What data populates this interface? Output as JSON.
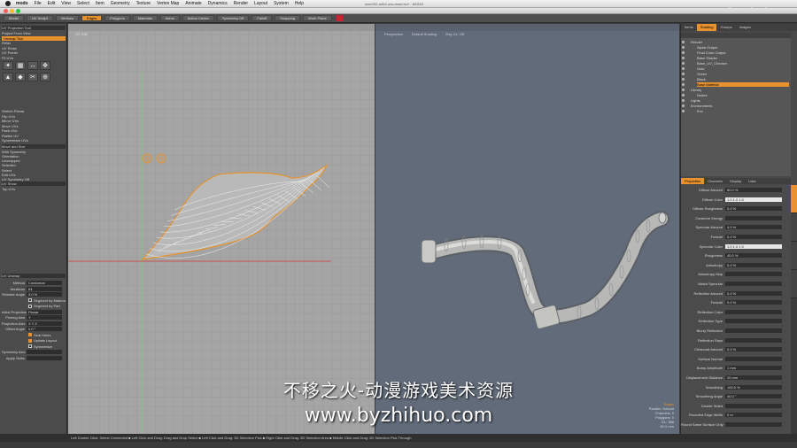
{
  "menubar": {
    "app_name": "modo",
    "items": [
      "File",
      "Edit",
      "View",
      "Select",
      "Item",
      "Geometry",
      "Texture",
      "Vertex Map",
      "Animate",
      "Dynamics",
      "Render",
      "Layout",
      "System",
      "Help"
    ],
    "window_title": "mdo202-a404-uvs-done.lxo* - MODO",
    "clock": "",
    "logo": "fxphd"
  },
  "toolbar": {
    "tabs": [
      "Model",
      "UV Sculpt",
      "Vertices",
      "Edges",
      "Polygons",
      "Materials",
      "Items",
      "Action Center",
      "Symmetry Off",
      "Falloff",
      "Snapping",
      "Work Plane"
    ],
    "active_tab": "Edges"
  },
  "left_panel": {
    "header": "UV Projection Tool",
    "rows": [
      "Project From View",
      "Unwrap Tool",
      "Relax",
      "UV Relax",
      "UV Peeler",
      "Fit UVs"
    ],
    "unwrap_label": "Unwrap Tool",
    "section2": [
      "Stretch Planar",
      "Flip UVs",
      "Mirror UVs",
      "Move UVs",
      "Pack UVs",
      "Flatten UV",
      "Symmetrize UVs"
    ],
    "section3_header": "Move and Size",
    "section3": [
      "With Symmetry",
      "Orientation",
      "Unwrapped",
      "Selected"
    ],
    "section4": [
      "Select",
      "Edit UVs",
      "UV Symmetry Off"
    ],
    "section5_header": "UV Show",
    "section5": [
      "Top UVs"
    ],
    "lower_header": "UV Unwrap",
    "fields": [
      {
        "label": "Method",
        "value": "Conformal"
      },
      {
        "label": "Iterations",
        "value": "64"
      },
      {
        "label": "Relative Angle",
        "value": "3.0 %"
      }
    ],
    "checks1": [
      {
        "label": "Segment by Material",
        "on": false
      },
      {
        "label": "Segment by Part",
        "on": false
      }
    ],
    "fields2": [
      {
        "label": "Initial Projection",
        "value": "Planar"
      },
      {
        "label": "Pinning Axis",
        "value": "Y"
      },
      {
        "label": "Projection Axis",
        "value": "X  Y  Z"
      },
      {
        "label": "Offset Angle",
        "value": "0.0 °"
      }
    ],
    "checks2": [
      {
        "label": "Seal Holes",
        "on": true
      },
      {
        "label": "Update Layout",
        "on": true
      },
      {
        "label": "Symmetrize",
        "on": false
      }
    ],
    "fields3": [
      {
        "label": "Symmetry Axis",
        "value": ""
      },
      {
        "label": "Apply Sides",
        "value": ""
      }
    ]
  },
  "viewport_left": {
    "label": "UV Edit"
  },
  "viewport_right": {
    "labels": [
      "Perspective",
      "Default Shading",
      "Ray GL: Off"
    ],
    "info": [
      "Edges",
      "Parallel: Default",
      "Channels: 0",
      "Polygons: 0",
      "GL: 388",
      "60.0 mm"
    ]
  },
  "right_panel": {
    "top_tabs": [
      "Items",
      "Shading",
      "Groups",
      "Images"
    ],
    "active_top_tab": "Shading",
    "tree_rows": [
      {
        "text": "Render",
        "indent": 1,
        "sel": false
      },
      {
        "text": "Alpha Output",
        "indent": 2,
        "sel": false
      },
      {
        "text": "Final Color Output",
        "indent": 2,
        "sel": false
      },
      {
        "text": "Base Shader",
        "indent": 2,
        "sel": false
      },
      {
        "text": "Base_UV_Checker",
        "indent": 2,
        "sel": false
      },
      {
        "text": "Gold",
        "indent": 2,
        "sel": false
      },
      {
        "text": "Green",
        "indent": 2,
        "sel": false
      },
      {
        "text": "Black",
        "indent": 2,
        "sel": false
      },
      {
        "text": "Base Material",
        "indent": 2,
        "sel": true
      },
      {
        "text": "Library",
        "indent": 1,
        "sel": false
      },
      {
        "text": "Nodes",
        "indent": 2,
        "sel": false
      },
      {
        "text": "Lights",
        "indent": 1,
        "sel": false
      },
      {
        "text": "Environments",
        "indent": 1,
        "sel": false
      },
      {
        "text": "Env",
        "indent": 2,
        "sel": false
      }
    ],
    "prop_tabs": [
      "Properties",
      "Channels",
      "Display",
      "Lists"
    ],
    "active_prop_tab": "Properties",
    "props": [
      {
        "label": "Diffuse Amount",
        "value": "80.0 %",
        "white": false
      },
      {
        "label": "Diffuse Color",
        "value": "1.0      1.0      1.0",
        "white": true
      },
      {
        "label": "Diffuse Roughness",
        "value": "0.0 %",
        "white": false
      },
      {
        "label": "Conserve Energy",
        "value": "",
        "white": false
      },
      {
        "label": "Specular Amount",
        "value": "4.0 %",
        "white": false
      },
      {
        "label": "Fresnel",
        "value": "0.0 %",
        "white": false
      },
      {
        "label": "Specular Color",
        "value": "1.0      1.0      1.0",
        "white": true
      },
      {
        "label": "Roughness",
        "value": "40.0 %",
        "white": false
      },
      {
        "label": "Anisotropy",
        "value": "0.0 %",
        "white": false
      },
      {
        "label": "Anisotropy Map",
        "value": "",
        "white": false
      },
      {
        "label": "Match Specular",
        "value": "",
        "white": false
      },
      {
        "label": "Reflection Amount",
        "value": "0.0 %",
        "white": false
      },
      {
        "label": "Fresnel",
        "value": "0.0 %",
        "white": false
      },
      {
        "label": "Reflection Color",
        "value": "",
        "white": false
      },
      {
        "label": "Reflection Type",
        "value": "",
        "white": false
      },
      {
        "label": "Blurry Reflection",
        "value": "",
        "white": false
      },
      {
        "label": "Reflection Rays",
        "value": "",
        "white": false
      },
      {
        "label": "Clearcoat Amount",
        "value": "0.0 %",
        "white": false
      },
      {
        "label": "Surface Normal",
        "value": "",
        "white": false
      },
      {
        "label": "Bump Amplitude",
        "value": "1 mm",
        "white": false
      },
      {
        "label": "Displacement Distance",
        "value": "20 mm",
        "white": false
      },
      {
        "label": "Smoothing",
        "value": "100.0 %",
        "white": false
      },
      {
        "label": "Smoothing Angle",
        "value": "40.0 °",
        "white": false
      },
      {
        "label": "Double Sided",
        "value": "",
        "white": false
      },
      {
        "label": "Rounded Edge Width",
        "value": "0 m",
        "white": false
      },
      {
        "label": "Round Same Surface Only",
        "value": "",
        "white": false
      }
    ]
  },
  "status_bar": {
    "text": "Left Double Click: Select Connected ■ Left Click and Drag: Drag and Drop Select ■ Left Click and Drag: 3D Selection Pick ■ Right Click and Drag: 3D Selection Area ■ Middle Click and Drag: 3D Selection Pick Through"
  },
  "watermark": {
    "line1": "不移之火-动漫游戏美术资源",
    "line2": "www.byzhihuo.com"
  }
}
